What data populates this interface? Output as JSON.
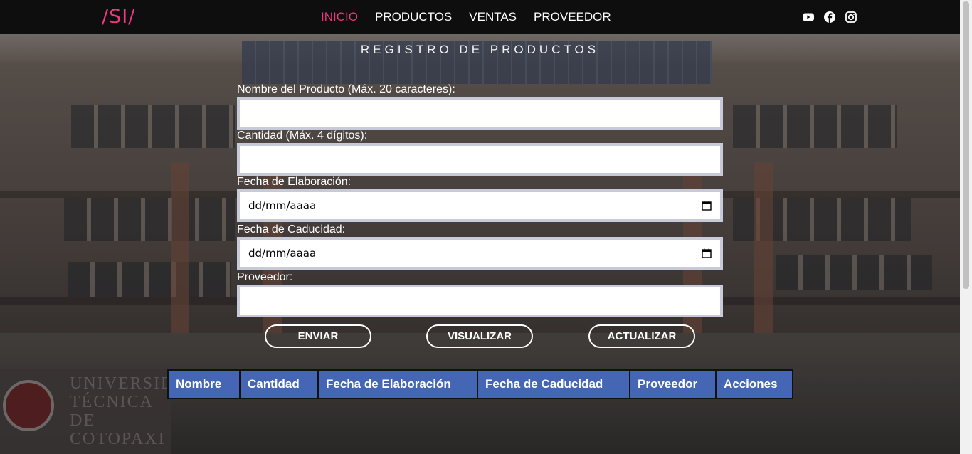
{
  "nav": {
    "brand": "/SI/",
    "links": [
      "INICIO",
      "PRODUCTOS",
      "VENTAS",
      "PROVEEDOR"
    ],
    "active_link": "INICIO",
    "social_icons": [
      "youtube-icon",
      "facebook-icon",
      "instagram-icon"
    ]
  },
  "form": {
    "title": "REGISTRO DE PRODUCTOS",
    "fields": [
      {
        "label": "Nombre del Producto (Máx. 20 caracteres):",
        "value": ""
      },
      {
        "label": "Cantidad (Máx. 4 dígitos):",
        "value": ""
      },
      {
        "label": "Fecha de Elaboración:",
        "value": "dd/mm/aaaa"
      },
      {
        "label": "Fecha de Caducidad:",
        "value": "dd/mm/aaaa"
      },
      {
        "label": "Proveedor:",
        "value": ""
      }
    ],
    "buttons": [
      "ENVIAR",
      "VISUALIZAR",
      "ACTUALIZAR"
    ]
  },
  "table": {
    "headers": [
      "Nombre",
      "Cantidad",
      "Fecha de Elaboración",
      "Fecha de Caducidad",
      "Proveedor",
      "Acciones"
    ]
  },
  "background": {
    "sign_text": "UNIVERSIDAD TÉCNICA DE COTOPAXI"
  },
  "colors": {
    "accent": "#ec3a7e",
    "navbar": "#0f0e0e",
    "table_header": "#4466b4",
    "input_border": "#c7cad9"
  }
}
